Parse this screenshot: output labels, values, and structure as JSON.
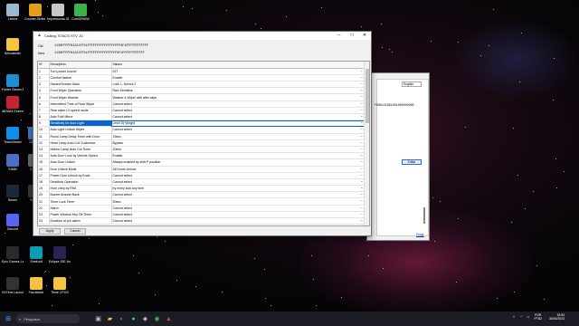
{
  "desktop": {
    "icons": [
      {
        "label": "Lixeira",
        "color": "#9ab8d0"
      },
      {
        "label": "Counter-Strike Global Offensive",
        "color": "#e49e1f"
      },
      {
        "label": "Impressoras 3D",
        "color": "#c8c8c8"
      },
      {
        "label": "CorelDRAW",
        "color": "#3bb34a"
      },
      {
        "label": "IMlousbotic",
        "color": "#f5c342"
      },
      {
        "label": "Folder Steam Explorer",
        "color": "#1c8fd0"
      },
      {
        "label": "AIDA64 Extreme",
        "color": "#c0262b"
      },
      {
        "label": "TeamViewer",
        "color": "#0e8ee9"
      },
      {
        "label": "SIMM",
        "color": "#4a6fc4"
      },
      {
        "label": "Steam",
        "color": "#1b2838"
      },
      {
        "label": "Discord",
        "color": "#5865f2"
      },
      {
        "label": "CPUID",
        "color": "#3d7ac2"
      },
      {
        "label": "CPUZ",
        "color": "#6a6a6a"
      },
      {
        "label": "Sheet",
        "color": "#3a3a3a"
      },
      {
        "label": "Epic Games Launcher",
        "color": "#2a2a2a"
      },
      {
        "label": "Shelicult",
        "color": "#0a9db8"
      },
      {
        "label": "Eclipse IDE for Java De...",
        "color": "#2c2255"
      },
      {
        "label": "Hi Elms Launcher",
        "color": "#333"
      },
      {
        "label": "Faculdade",
        "color": "#f5c342"
      },
      {
        "label": "Teste CPUS",
        "color": "#f5c342"
      }
    ]
  },
  "back_window": {
    "language": "English",
    "hex": "FD6013CAD1001000000000",
    "edit_button": "Editar",
    "close_link": "Fecgr"
  },
  "dialog": {
    "title": "Coding: STACS STV JO",
    "old_label": "Old",
    "old_value": "1130FFFFF01221FF51FFFFFFFFFFFFFFFFFF0F1FFFFFFFFFFFF",
    "new_label": "New",
    "new_value": "1130FFFFF01221FF51FFFFFFFFFFFFFFFF0F1FFFFFFFFFFFF",
    "columns": [
      "Nº",
      "Description",
      "Values"
    ],
    "rows": [
      {
        "n": "1",
        "desc": "Turn power source",
        "val": "IGT"
      },
      {
        "n": "2",
        "desc": "Comfort flasher",
        "val": "Enable"
      },
      {
        "n": "3",
        "desc": "Hazard Answer Back",
        "val": "Lock 1, Unlock 2"
      },
      {
        "n": "4",
        "desc": "Front Wiper Operation",
        "val": "Rain Sensitive"
      },
      {
        "n": "5",
        "desc": "Front Wiper Washer",
        "val": "Washer & Wiper with after wipe"
      },
      {
        "n": "6",
        "desc": "Intermittent Time of Rear Wiper",
        "val": "Cannot select"
      },
      {
        "n": "7",
        "desc": "Rear wiper L0 speed mode",
        "val": "Cannot select"
      },
      {
        "n": "8",
        "desc": "Auto Fold Mirror",
        "val": "Cannot select"
      },
      {
        "n": "9",
        "desc": "Sensitivity for Auto Light",
        "val": "Level 5(+)bright"
      },
      {
        "n": "10",
        "desc": "Auto Light Unlock Wiper",
        "val": "Cannot select"
      },
      {
        "n": "11",
        "desc": "Room Lamp Delay Timer with Door",
        "val": "15sec"
      },
      {
        "n": "12",
        "desc": "Head Lamp Auto Cut Customize",
        "val": "Bypass"
      },
      {
        "n": "13",
        "desc": "Interior Lamp Auto Cut Timer",
        "val": "20min"
      },
      {
        "n": "14",
        "desc": "Auto Door Lock by Vehicle Speed",
        "val": "Enable"
      },
      {
        "n": "15",
        "desc": "Auto Door Unlock",
        "val": "Always enabled by shift P position"
      },
      {
        "n": "16",
        "desc": "Door Unlock Mode",
        "val": "All Doors Unlock"
      },
      {
        "n": "17",
        "desc": "Power Door Unlock by Knob",
        "val": "Cannot select"
      },
      {
        "n": "18",
        "desc": "Deadlock Operation",
        "val": "Cannot select"
      },
      {
        "n": "19",
        "desc": "Horn chirp by RKE",
        "val": "by every lock any time"
      },
      {
        "n": "20",
        "desc": "Buzzer Answer Back",
        "val": "Cannot select"
      },
      {
        "n": "21",
        "desc": "Timer Lock Timer",
        "val": "30sec"
      },
      {
        "n": "22",
        "desc": "Alarm",
        "val": "Cannot select"
      },
      {
        "n": "23",
        "desc": "Power Window Key Off Timer",
        "val": "Cannot select"
      },
      {
        "n": "24",
        "desc": "Duration of pre-alarm",
        "val": "Cannot select"
      }
    ],
    "selected_row": 8,
    "apply_label": "Apply",
    "cancel_label": "Cancel"
  },
  "taskbar": {
    "search_placeholder": "Pesquisar",
    "lang_line1": "POR",
    "lang_line2": "PTB2",
    "time": "18:53",
    "date": "30/04/2023"
  },
  "colors": {
    "selection": "#0a64d0",
    "accent": "#2a6ad9"
  }
}
